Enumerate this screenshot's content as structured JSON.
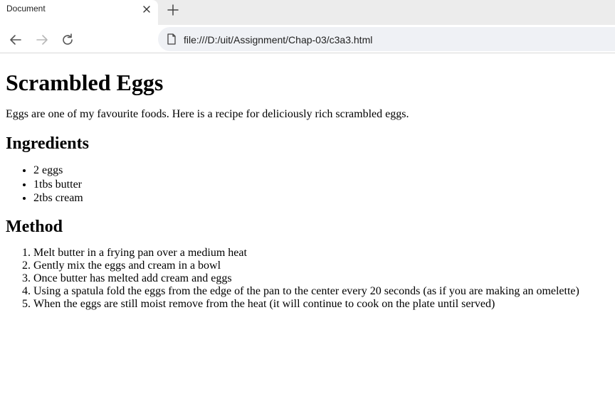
{
  "browser": {
    "tab_title": "Document",
    "url": "file:///D:/uit/Assignment/Chap-03/c3a3.html"
  },
  "page": {
    "title": "Scrambled Eggs",
    "intro": "Eggs are one of my favourite foods. Here is a recipe for deliciously rich scrambled eggs.",
    "ingredients_heading": "Ingredients",
    "ingredients": [
      "2 eggs",
      "1tbs butter",
      "2tbs cream"
    ],
    "method_heading": "Method",
    "method": [
      "Melt butter in a frying pan over a medium heat",
      "Gently mix the eggs and cream in a bowl",
      "Once butter has melted add cream and eggs",
      "Using a spatula fold the eggs from the edge of the pan to the center every 20 seconds (as if you are making an omelette)",
      "When the eggs are still moist remove from the heat (it will continue to cook on the plate until served)"
    ]
  },
  "icons": {
    "close": "close-icon",
    "new_tab": "plus-icon",
    "back": "arrow-left-icon",
    "forward": "arrow-right-icon",
    "reload": "reload-icon",
    "page": "file-icon"
  }
}
